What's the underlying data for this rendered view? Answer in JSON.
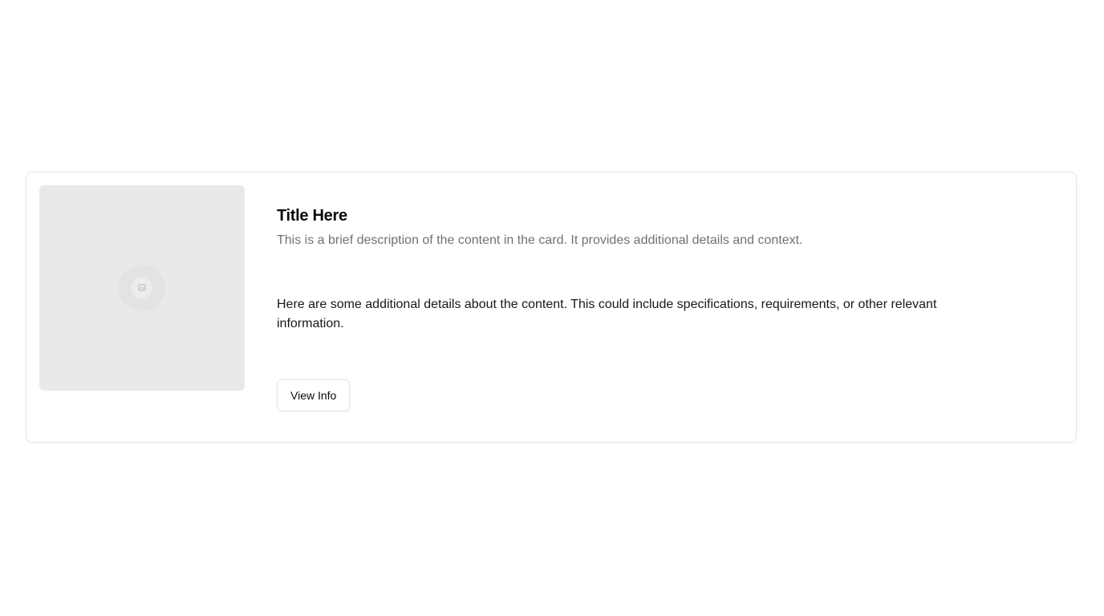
{
  "card": {
    "title": "Title Here",
    "description": "This is a brief description of the content in the card. It provides additional details and context.",
    "details": "Here are some additional details about the content. This could include specifications, requirements, or other relevant information.",
    "button_label": "View Info",
    "image_icon": "image-placeholder-icon"
  },
  "colors": {
    "card_border": "#e4e4e7",
    "image_background": "#e9e9e9",
    "title": "#0a0a0a",
    "description": "#71717a",
    "details": "#18181b"
  }
}
